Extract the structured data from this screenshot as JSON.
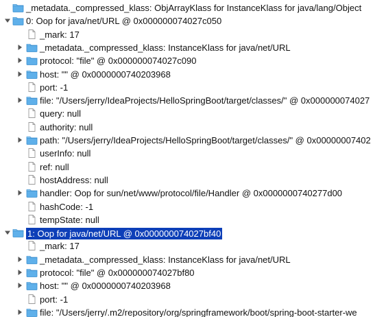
{
  "tree": {
    "rows": [
      {
        "label": "_metadata._compressed_klass: ObjArrayKlass for InstanceKlass for java/lang/Object",
        "depth": 0,
        "toggle": "none",
        "icon": "folder"
      },
      {
        "label": "0: Oop for java/net/URL @ 0x000000074027c050",
        "depth": 0,
        "toggle": "expanded",
        "icon": "folder"
      },
      {
        "label": "_mark: 17",
        "depth": 1,
        "toggle": "none",
        "icon": "file"
      },
      {
        "label": "_metadata._compressed_klass: InstanceKlass for java/net/URL",
        "depth": 1,
        "toggle": "collapsed",
        "icon": "folder"
      },
      {
        "label": "protocol: \"file\" @ 0x000000074027c090",
        "depth": 1,
        "toggle": "collapsed",
        "icon": "folder"
      },
      {
        "label": "host: \"\" @ 0x0000000740203968",
        "depth": 1,
        "toggle": "collapsed",
        "icon": "folder"
      },
      {
        "label": "port: -1",
        "depth": 1,
        "toggle": "none",
        "icon": "file"
      },
      {
        "label": "file: \"/Users/jerry/IdeaProjects/HelloSpringBoot/target/classes/\" @ 0x000000074027",
        "depth": 1,
        "toggle": "collapsed",
        "icon": "folder"
      },
      {
        "label": "query: null",
        "depth": 1,
        "toggle": "none",
        "icon": "file"
      },
      {
        "label": "authority: null",
        "depth": 1,
        "toggle": "none",
        "icon": "file"
      },
      {
        "label": "path: \"/Users/jerry/IdeaProjects/HelloSpringBoot/target/classes/\" @ 0x00000007402",
        "depth": 1,
        "toggle": "collapsed",
        "icon": "folder"
      },
      {
        "label": "userInfo: null",
        "depth": 1,
        "toggle": "none",
        "icon": "file"
      },
      {
        "label": "ref: null",
        "depth": 1,
        "toggle": "none",
        "icon": "file"
      },
      {
        "label": "hostAddress: null",
        "depth": 1,
        "toggle": "none",
        "icon": "file"
      },
      {
        "label": "handler: Oop for sun/net/www/protocol/file/Handler @ 0x0000000740277d00",
        "depth": 1,
        "toggle": "collapsed",
        "icon": "folder"
      },
      {
        "label": "hashCode: -1",
        "depth": 1,
        "toggle": "none",
        "icon": "file"
      },
      {
        "label": "tempState: null",
        "depth": 1,
        "toggle": "none",
        "icon": "file"
      },
      {
        "label": "1: Oop for java/net/URL @ 0x000000074027bf40",
        "depth": 0,
        "toggle": "expanded",
        "icon": "folder",
        "selected": true
      },
      {
        "label": "_mark: 17",
        "depth": 1,
        "toggle": "none",
        "icon": "file"
      },
      {
        "label": "_metadata._compressed_klass: InstanceKlass for java/net/URL",
        "depth": 1,
        "toggle": "collapsed",
        "icon": "folder"
      },
      {
        "label": "protocol: \"file\" @ 0x000000074027bf80",
        "depth": 1,
        "toggle": "collapsed",
        "icon": "folder"
      },
      {
        "label": "host: \"\" @ 0x0000000740203968",
        "depth": 1,
        "toggle": "collapsed",
        "icon": "folder"
      },
      {
        "label": "port: -1",
        "depth": 1,
        "toggle": "none",
        "icon": "file"
      },
      {
        "label": "file: \"/Users/jerry/.m2/repository/org/springframework/boot/spring-boot-starter-we",
        "depth": 1,
        "toggle": "collapsed",
        "icon": "folder"
      }
    ]
  },
  "colors": {
    "folder_fill": "#5fb0ea",
    "folder_tab": "#8ccaf3",
    "folder_edge": "#3a8fd0",
    "file_edge": "#9a9a9a",
    "selection": "#0d3fb8",
    "toggle": "#555555"
  },
  "icons": {
    "folder": "folder-icon",
    "file": "file-icon",
    "expanded": "triangle-down-icon",
    "collapsed": "triangle-right-icon"
  }
}
